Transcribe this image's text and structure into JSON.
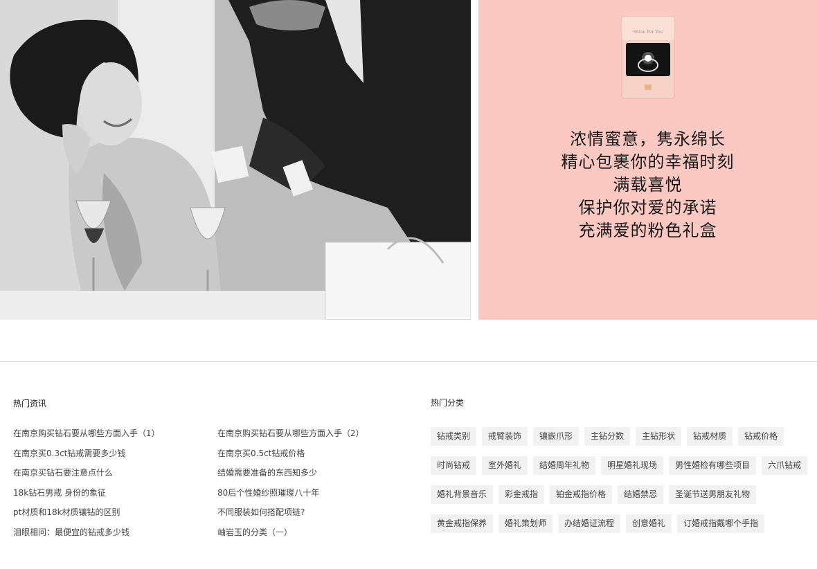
{
  "banner": {
    "photo_alt": "",
    "ring_box_text": "Shine For You",
    "promo_lines": [
      "浓情蜜意，隽永绵长",
      "精心包裹你的幸福时刻",
      "满载喜悦",
      "保护你对爱的承诺",
      "充满爱的粉色礼盒"
    ],
    "promo_bg": "#fcc8c2"
  },
  "news": {
    "title": "热门资讯",
    "left": [
      "在南京购买钻石要从哪些方面入手（1）",
      "在南京买0.3ct钻戒需要多少钱",
      "在南京买钻石要注意点什么",
      "18k钻石男戒 身份的象征",
      "pt材质和18k材质镶钻的区别",
      "泪眼相问：最便宜的钻戒多少钱"
    ],
    "right": [
      "在南京购买钻石要从哪些方面入手（2）",
      "在南京买0.5ct钻戒价格",
      "结婚需要准备的东西知多少",
      "80后个性婚纱照璀璨八十年",
      "不同服装如何搭配项链?",
      "岫岩玉的分类（一）"
    ]
  },
  "categories": {
    "title": "热门分类",
    "rows": [
      [
        "钻戒类别",
        "戒臂装饰",
        "镶嵌爪形",
        "主钻分数",
        "主钻形状",
        "钻戒材质",
        "钻戒价格"
      ],
      [
        "时尚钻戒",
        "室外婚礼",
        "结婚周年礼物",
        "明星婚礼现场",
        "男性婚检有哪些项目",
        "六爪钻戒"
      ],
      [
        "婚礼背景音乐",
        "彩金戒指",
        "铂金戒指价格",
        "结婚禁忌",
        "圣诞节送男朋友礼物"
      ],
      [
        "黄金戒指保养",
        "婚礼策划师",
        "办结婚证流程",
        "创意婚礼",
        "订婚戒指戴哪个手指"
      ]
    ]
  }
}
